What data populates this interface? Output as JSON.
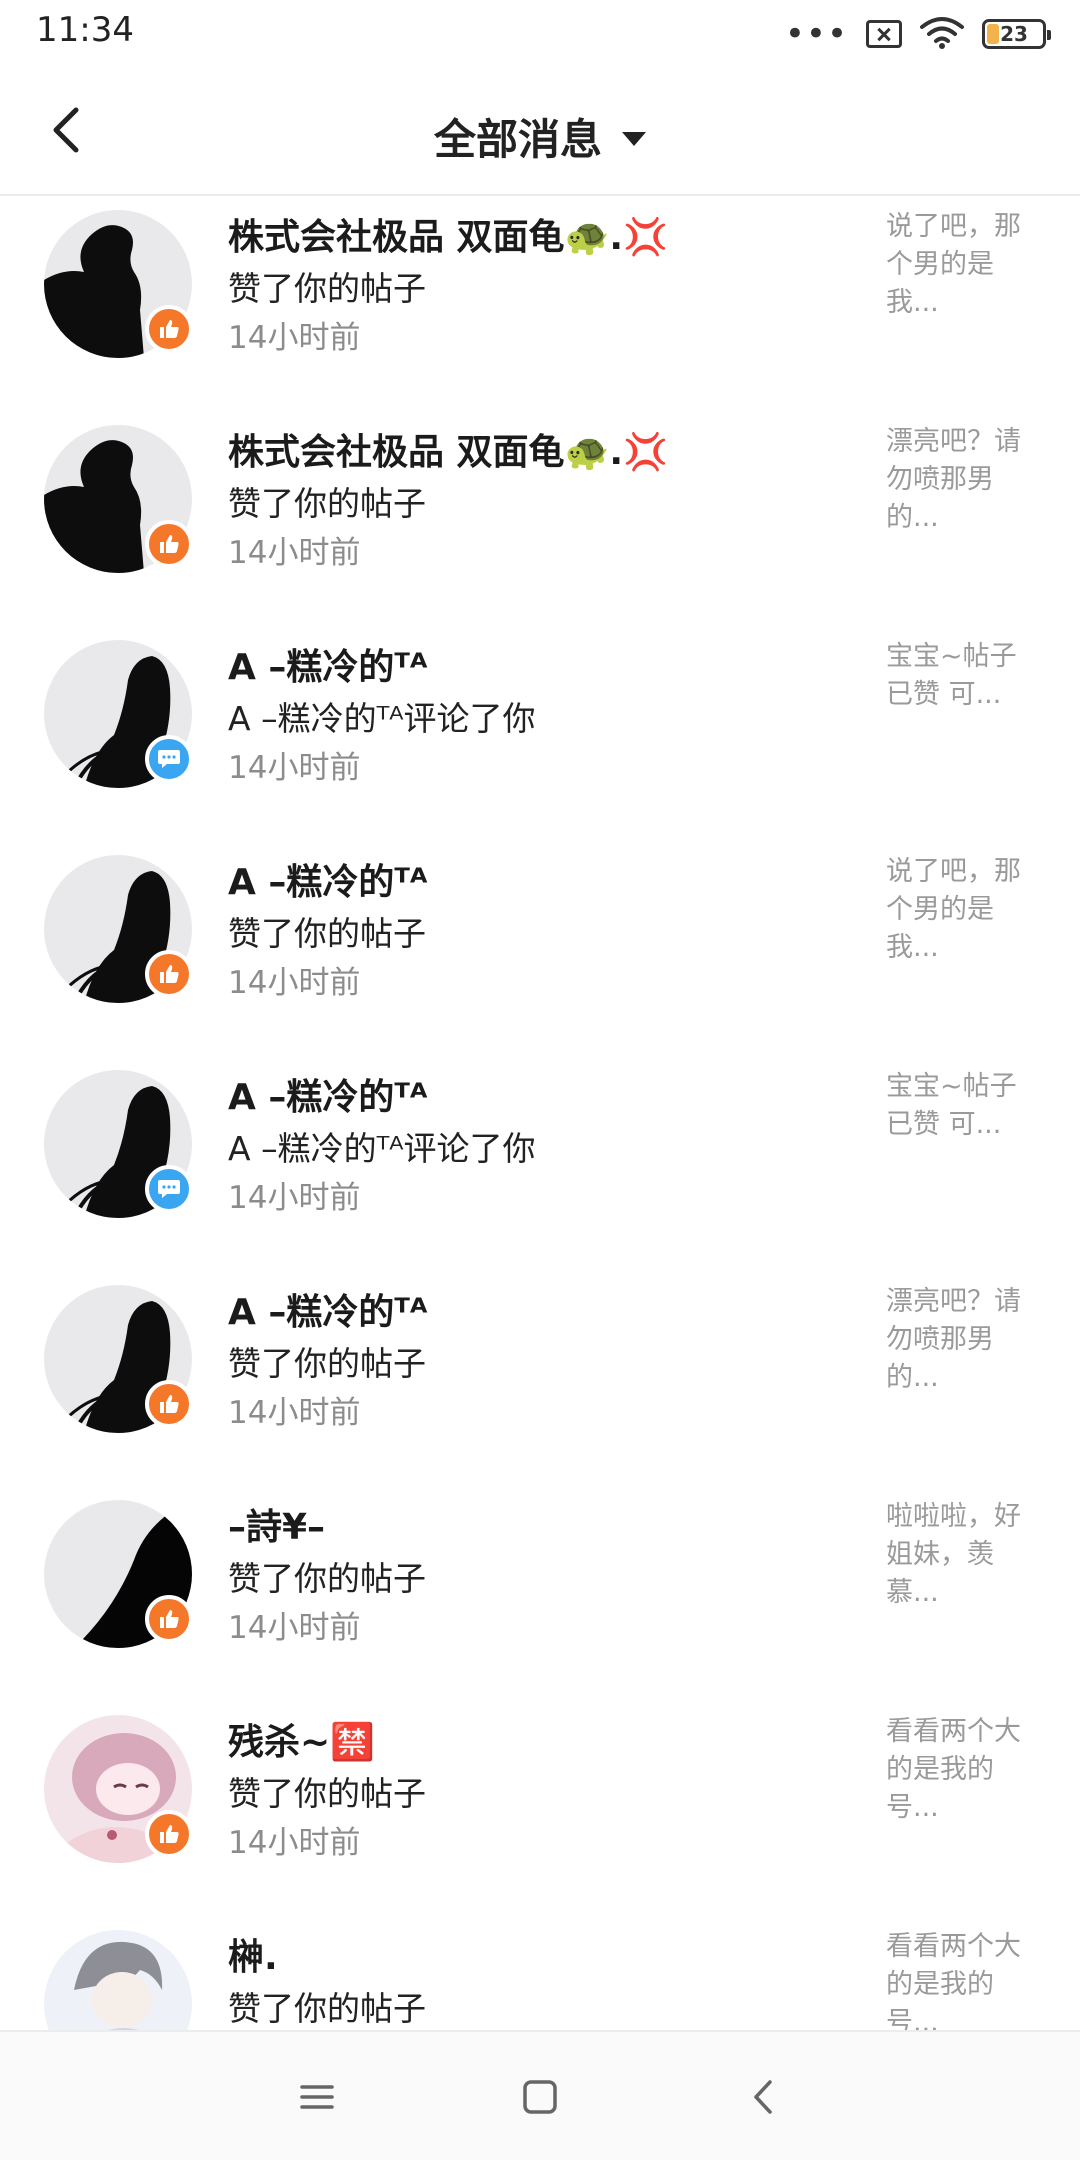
{
  "status_bar": {
    "time": "11:34",
    "battery": "23",
    "icons": [
      "dots-icon",
      "sim-off-icon",
      "wifi-icon",
      "battery-icon"
    ]
  },
  "header": {
    "title": "全部消息",
    "back_icon": "chevron-left-icon",
    "dropdown_icon": "caret-down-icon"
  },
  "messages": [
    {
      "name": "株式会社极品 双面龟🐢.💢",
      "action": "赞了你的帖子",
      "time": "14小时前",
      "type": "like",
      "preview": "说了吧，那个男的是我..."
    },
    {
      "name": "株式会社极品 双面龟🐢.💢",
      "action": "赞了你的帖子",
      "time": "14小时前",
      "type": "like",
      "preview": "漂亮吧？请勿喷那男的..."
    },
    {
      "name": "A –糕冷的ᵀᴬ",
      "action": "A –糕冷的ᵀᴬ评论了你",
      "time": "14小时前",
      "type": "comment",
      "preview": "宝宝~帖子已赞  可..."
    },
    {
      "name": "A –糕冷的ᵀᴬ",
      "action": "赞了你的帖子",
      "time": "14小时前",
      "type": "like",
      "preview": "说了吧，那个男的是我..."
    },
    {
      "name": "A –糕冷的ᵀᴬ",
      "action": "A –糕冷的ᵀᴬ评论了你",
      "time": "14小时前",
      "type": "comment",
      "preview": "宝宝~帖子已赞  可..."
    },
    {
      "name": "A –糕冷的ᵀᴬ",
      "action": "赞了你的帖子",
      "time": "14小时前",
      "type": "like",
      "preview": "漂亮吧？请勿喷那男的..."
    },
    {
      "name": "–詩¥–",
      "action": "赞了你的帖子",
      "time": "14小时前",
      "type": "like",
      "preview": "啦啦啦，好姐妹，羡慕..."
    },
    {
      "name": "残杀~🈲",
      "action": "赞了你的帖子",
      "time": "14小时前",
      "type": "like",
      "preview": "看看两个大的是我的号..."
    },
    {
      "name": "榊.",
      "action": "赞了你的帖子",
      "time": "",
      "type": "like",
      "preview": "看看两个大的是我的号..."
    }
  ],
  "nav": {
    "icons": [
      "menu-icon",
      "home-square-icon",
      "back-triangle-icon"
    ]
  }
}
